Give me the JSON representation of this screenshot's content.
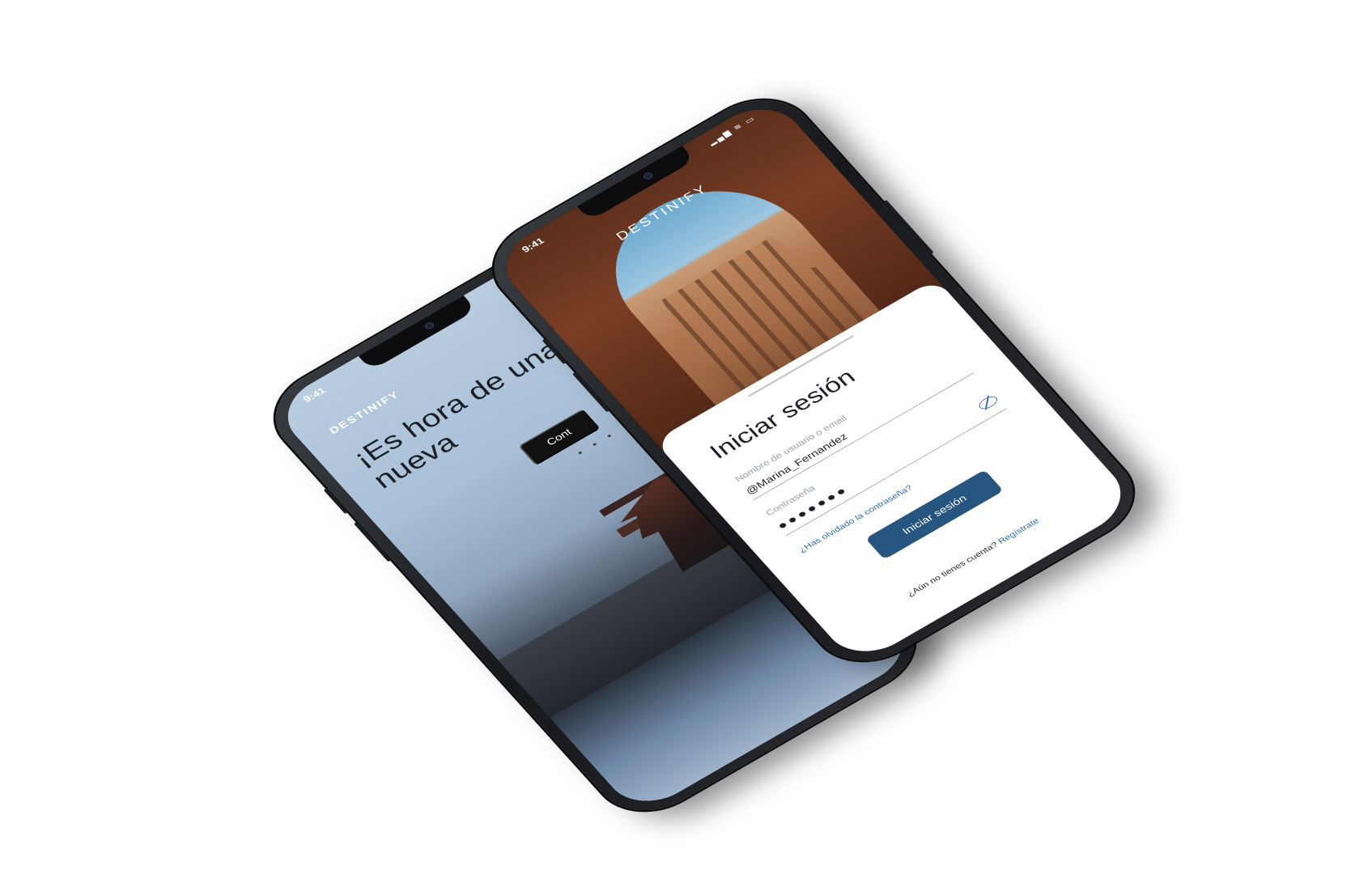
{
  "status_bar": {
    "time": "9:41",
    "icons": "▂▄▆ ≋ ▭"
  },
  "welcome_screen": {
    "brand": "DESTINIFY",
    "title": "¡Es hora de una nueva",
    "continue_label": "Cont",
    "pagination": "• • •"
  },
  "login_screen": {
    "brand": "DESTINIFY",
    "title": "Iniciar sesión",
    "username": {
      "label": "Nombre de usuario o email",
      "value": "@Marina_Fernandez"
    },
    "password": {
      "label": "Contraseña",
      "value": "●●●●●●●"
    },
    "forgot_link": "¿Has olvidado la contraseña?",
    "submit_label": "Iniciar sesión",
    "signup_prompt": "¿Aún no tienes cuenta?",
    "signup_link": "Regístrate"
  },
  "colors": {
    "primary_button": "#26557f",
    "link": "#2f6cb0"
  },
  "icons": [
    "eye-off-icon",
    "camera-icon",
    "signal-icon",
    "wifi-icon",
    "battery-icon"
  ]
}
